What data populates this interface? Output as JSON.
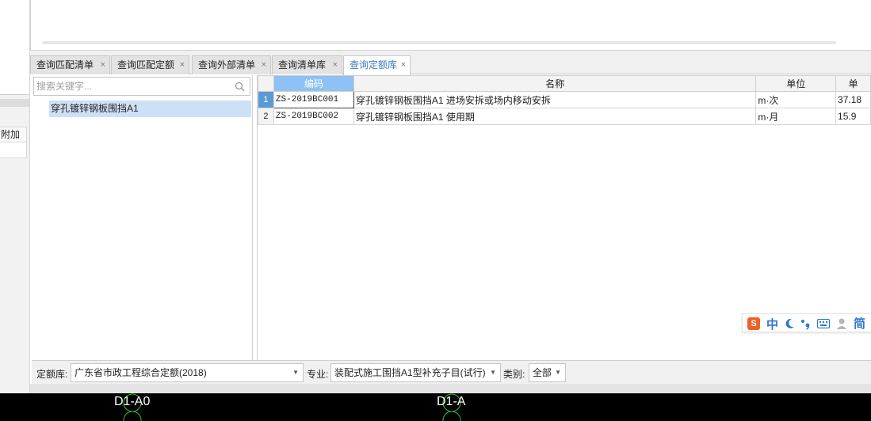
{
  "tabs": [
    {
      "label": "查询匹配清单",
      "active": false
    },
    {
      "label": "查询匹配定额",
      "active": false
    },
    {
      "label": "查询外部清单",
      "active": false
    },
    {
      "label": "查询清单库",
      "active": false
    },
    {
      "label": "查询定额库",
      "active": true
    }
  ],
  "tab_close_glyph": "×",
  "left_panel": {
    "addon_header": "附加"
  },
  "search": {
    "placeholder": "搜索关键字...",
    "value": "",
    "icon": "search-icon"
  },
  "tree": {
    "items": [
      "穿孔镀锌钢板围挡A1"
    ]
  },
  "grid": {
    "columns": [
      "编码",
      "名称",
      "单位",
      "单"
    ],
    "rows": [
      {
        "num": "1",
        "code": "ZS-2019BC001",
        "name": "穿孔镀锌钢板围挡A1 进场安拆或场内移动安拆",
        "unit": "m·次",
        "price": "37.18"
      },
      {
        "num": "2",
        "code": "ZS-2019BC002",
        "name": "穿孔镀锌钢板围挡A1 使用期",
        "unit": "m·月",
        "price": "15.9"
      }
    ]
  },
  "ime": {
    "logo": "sogou-logo",
    "mode": "中",
    "script": "简"
  },
  "filters": {
    "library_label": "定额库:",
    "library_value": "广东省市政工程综合定额(2018)",
    "specialty_label": "专业:",
    "specialty_value": "装配式施工围挡A1型补充子目(试行)",
    "category_label": "类别:",
    "category_value": "全部"
  },
  "cad_labels": [
    "D1-A0",
    "D1-A"
  ],
  "colors": {
    "accent": "#3b7bbf",
    "header_highlight": "#8ec1f4",
    "row_selected": "#5b9bd5",
    "tree_selected": "#cde0f6",
    "ime_orange": "#f0602a",
    "ime_blue": "#2f77d1",
    "cad_green": "#2fbf2f"
  }
}
